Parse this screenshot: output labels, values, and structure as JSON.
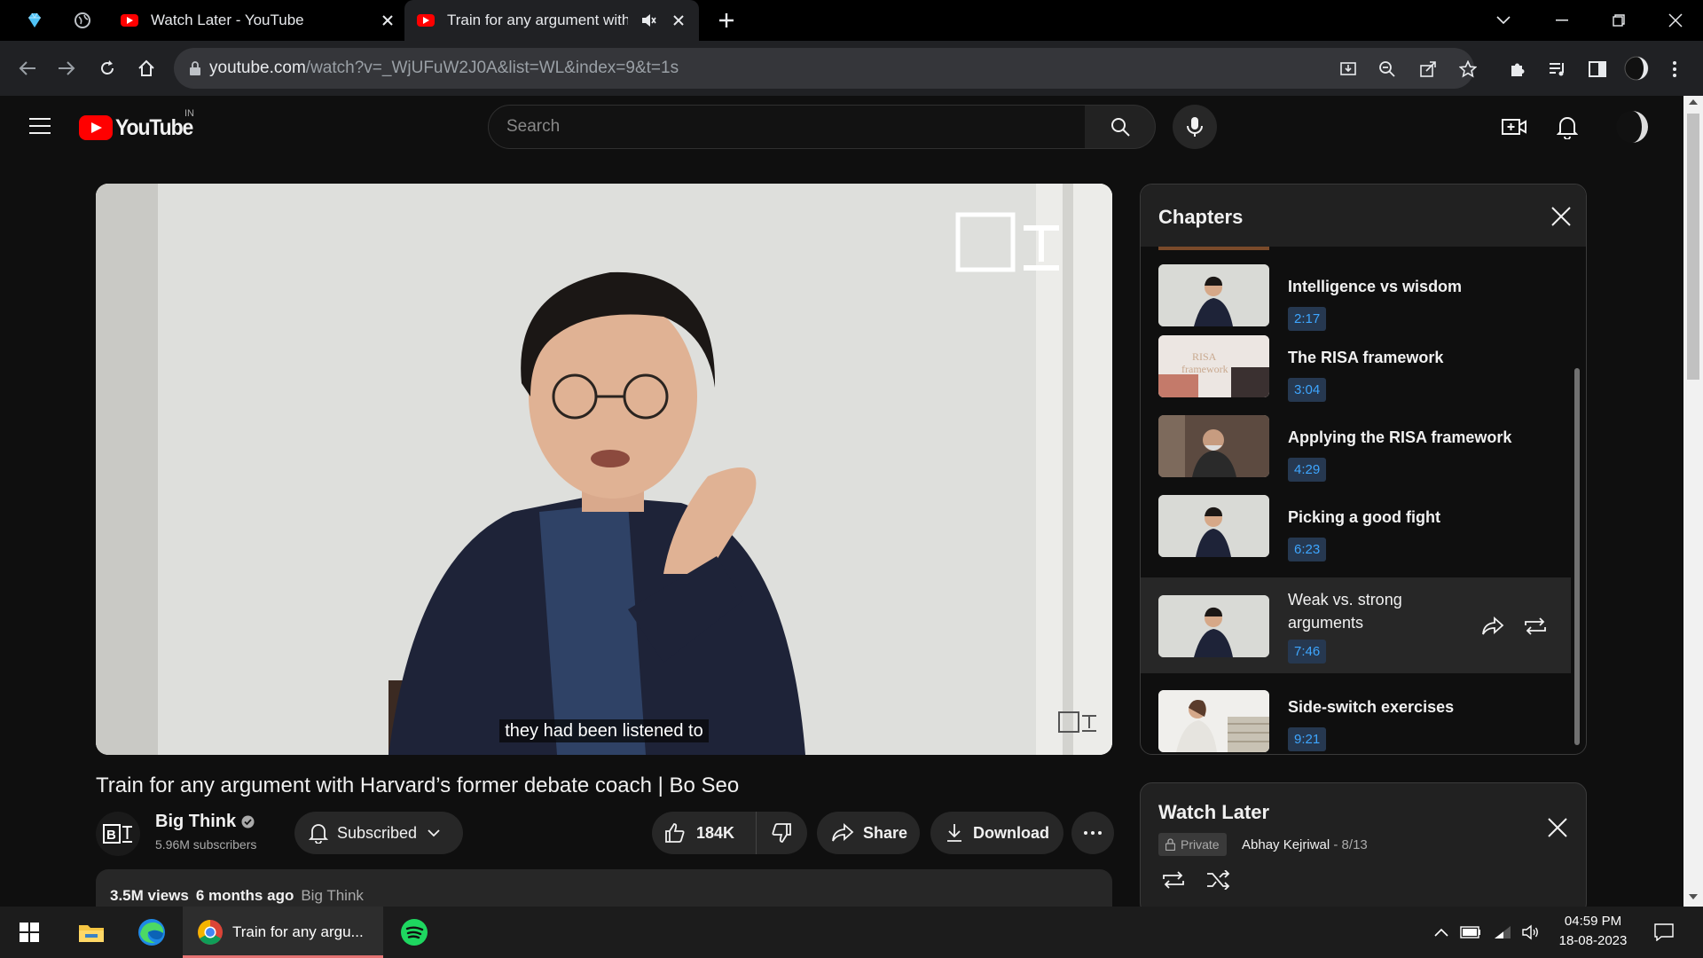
{
  "browser": {
    "tabs": [
      {
        "label": "Watch Later - YouTube"
      },
      {
        "label": "Train for any argument with Harvard's former debate coach | Bo Seo"
      }
    ],
    "url_host": "youtube.com",
    "url_path": "/watch?v=_WjUFuW2J0A&list=WL&index=9&t=1s"
  },
  "youtube": {
    "logo_text": "YouTube",
    "country_code": "IN",
    "search_placeholder": "Search"
  },
  "video": {
    "caption": "they had been listened to",
    "title": "Train for any argument with Harvard’s former debate coach | Bo Seo",
    "channel": "Big Think",
    "subscribers": "5.96M subscribers",
    "subscribe_label": "Subscribed",
    "likes": "184K",
    "share_label": "Share",
    "download_label": "Download",
    "views": "3.5M views",
    "age": "6 months ago",
    "desc_channel": "Big Think"
  },
  "chapters": {
    "heading": "Chapters",
    "items": [
      {
        "title": "Intelligence vs wisdom",
        "time": "2:17"
      },
      {
        "title": "The RISA framework",
        "time": "3:04"
      },
      {
        "title": "Applying the RISA framework",
        "time": "4:29"
      },
      {
        "title": "Picking a good fight",
        "time": "6:23"
      },
      {
        "title_line1": "Weak vs. strong",
        "title_line2": "arguments",
        "time": "7:46"
      },
      {
        "title": "Side-switch exercises",
        "time": "9:21"
      }
    ]
  },
  "watch_later": {
    "heading": "Watch Later",
    "privacy": "Private",
    "owner": "Abhay Kejriwal",
    "position": "- 8/13"
  },
  "taskbar": {
    "chrome_label": "Train for any argu...",
    "time": "04:59 PM",
    "date": "18-08-2023"
  },
  "colors": {
    "yt_red": "#ff0000",
    "chapter_time_text": "#3ea6ff",
    "background": "#0f0f0f"
  }
}
